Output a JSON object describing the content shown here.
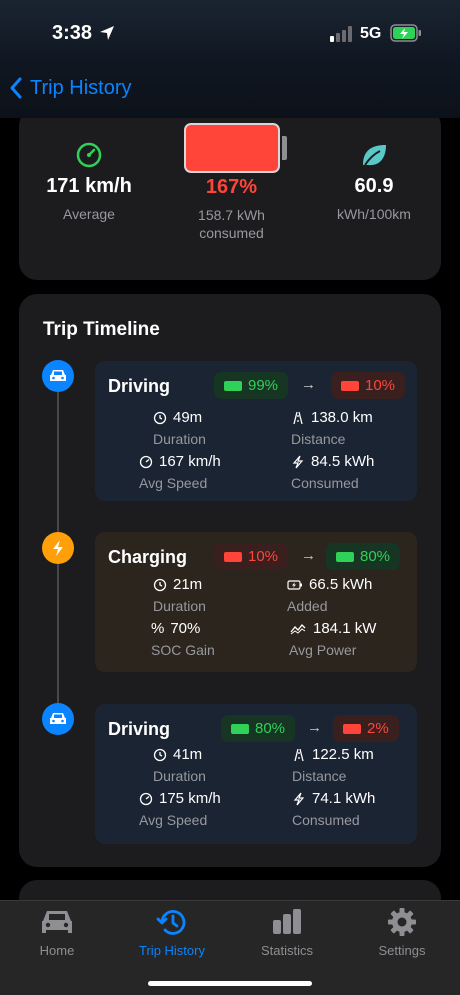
{
  "status_bar": {
    "time": "3:38",
    "network": "5G"
  },
  "nav": {
    "back_label": "Trip History"
  },
  "summary": {
    "speed_value": "171 km/h",
    "speed_label": "Average",
    "battery_pct": "167%",
    "battery_label": "158.7 kWh consumed",
    "battery_fill_fraction": 1.0,
    "efficiency_value": "60.9",
    "efficiency_label": "kWh/100km"
  },
  "timeline": {
    "title": "Trip Timeline",
    "segments": [
      {
        "type": "Driving",
        "soc_from": "99%",
        "soc_to": "10%",
        "m1_value": "49m",
        "m1_label": "Duration",
        "m2_value": "138.0 km",
        "m2_label": "Distance",
        "m3_value": "167 km/h",
        "m3_label": "Avg Speed",
        "m4_value": "84.5 kWh",
        "m4_label": "Consumed"
      },
      {
        "type": "Charging",
        "soc_from": "10%",
        "soc_to": "80%",
        "m1_value": "21m",
        "m1_label": "Duration",
        "m2_value": "66.5 kWh",
        "m2_label": "Added",
        "m3_value": "70%",
        "m3_label": "SOC Gain",
        "m4_value": "184.1 kW",
        "m4_label": "Avg Power"
      },
      {
        "type": "Driving",
        "soc_from": "80%",
        "soc_to": "2%",
        "m1_value": "41m",
        "m1_label": "Duration",
        "m2_value": "122.5 km",
        "m2_label": "Distance",
        "m3_value": "175 km/h",
        "m3_label": "Avg Speed",
        "m4_value": "74.1 kWh",
        "m4_label": "Consumed"
      }
    ]
  },
  "tabs": [
    {
      "label": "Home",
      "icon": "car-icon"
    },
    {
      "label": "Trip History",
      "icon": "clock-history-icon"
    },
    {
      "label": "Statistics",
      "icon": "bar-chart-icon"
    },
    {
      "label": "Settings",
      "icon": "gear-icon"
    }
  ],
  "colors": {
    "accent": "#0a84ff",
    "green": "#30d158",
    "red": "#ff453a",
    "orange": "#ff9f0a"
  }
}
